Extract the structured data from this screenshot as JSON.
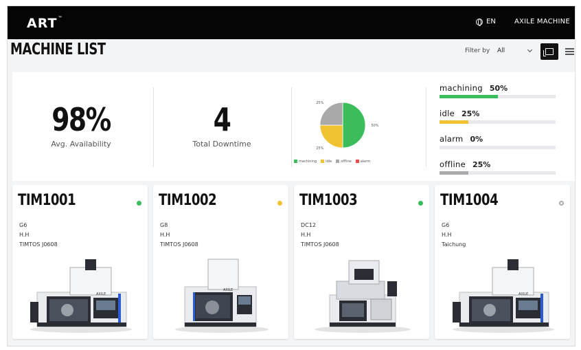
{
  "app": {
    "logo": "ART",
    "logo_tm": "™",
    "language": "EN",
    "user": "AXILE MACHINE"
  },
  "header": {
    "title": "MACHINE LIST",
    "filter_label": "Filter by",
    "filter_value": "All"
  },
  "summary": {
    "availability_value": "98%",
    "availability_label": "Avg. Availability",
    "downtime_value": "4",
    "downtime_label": "Total Downtime"
  },
  "chart_data": {
    "type": "pie",
    "labels": [
      "machining",
      "idle",
      "offline",
      "alarm"
    ],
    "values": [
      50,
      25,
      25,
      0
    ],
    "slice_labels": [
      "50%",
      "25%",
      "25%",
      ""
    ],
    "colors": [
      "#3cbd5b",
      "#f1c232",
      "#a9a9a9",
      "#ec4a4a"
    ],
    "legend_position": "bottom"
  },
  "statuses": [
    {
      "name": "machining",
      "percent": "50%",
      "fraction": 0.5,
      "color": "#3cbd5b"
    },
    {
      "name": "idle",
      "percent": "25%",
      "fraction": 0.25,
      "color": "#f1c232"
    },
    {
      "name": "alarm",
      "percent": "0%",
      "fraction": 0.0,
      "color": "#ec4a4a"
    },
    {
      "name": "offline",
      "percent": "25%",
      "fraction": 0.25,
      "color": "#a9a9a9"
    }
  ],
  "machines": [
    {
      "id": "TIM1001",
      "model": "G6",
      "owner": "H.H",
      "location": "TIMTOS J0608",
      "status_color": "#3cbd5b",
      "status_icon": "status-dot"
    },
    {
      "id": "TIM1002",
      "model": "G8",
      "owner": "H.H",
      "location": "TIMTOS J0608",
      "status_color": "#f1c232",
      "status_icon": "status-dot"
    },
    {
      "id": "TIM1003",
      "model": "DC12",
      "owner": "H.H",
      "location": "TIMTOS J0608",
      "status_color": "#3cbd5b",
      "status_icon": "status-dot"
    },
    {
      "id": "TIM1004",
      "model": "G6",
      "owner": "H.H",
      "location": "Taichung",
      "status_color": "#aaaaaa",
      "status_icon": "status-ring"
    }
  ],
  "machine_brand": "AXILE"
}
